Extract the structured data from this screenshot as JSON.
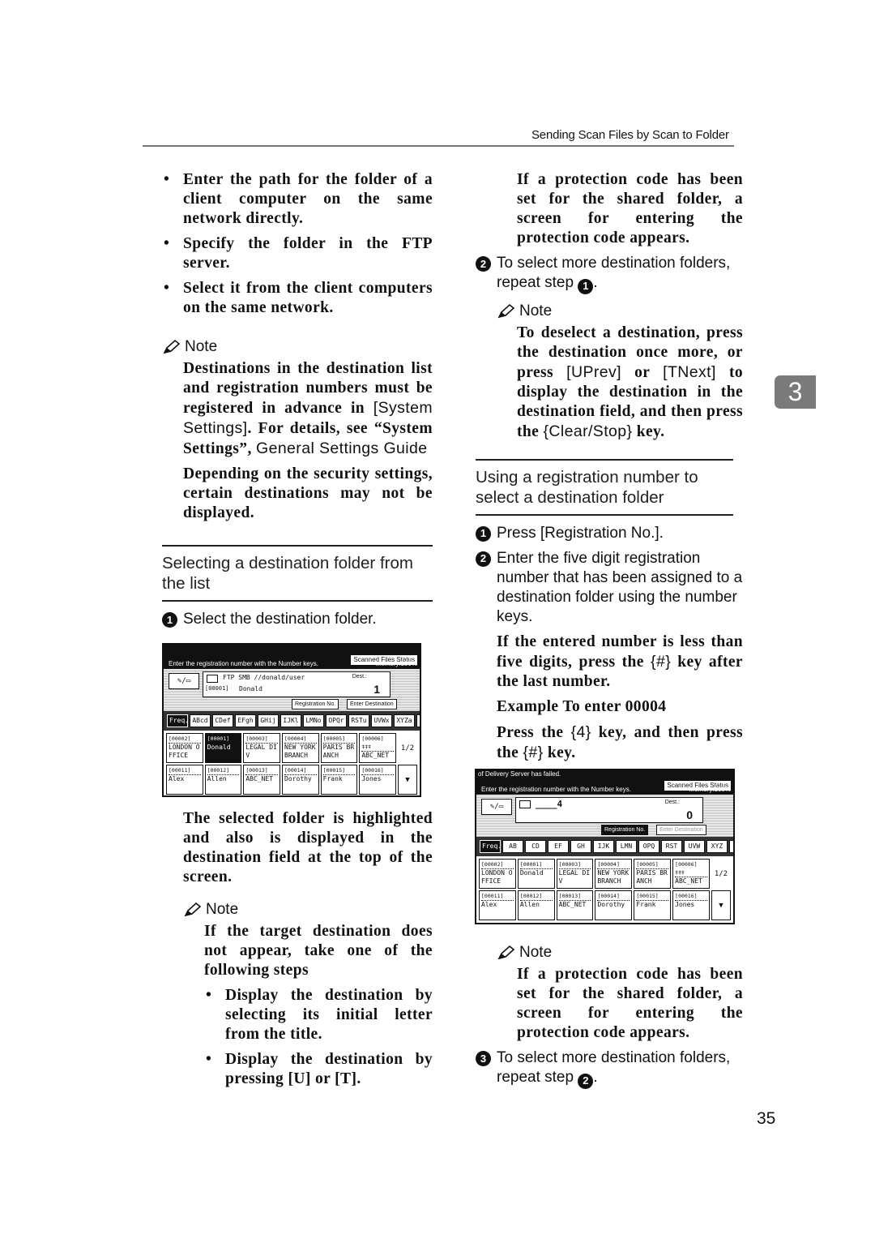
{
  "header": {
    "running_title": "Sending Scan Files by Scan to Folder"
  },
  "chapter_tab": "3",
  "page_number": "35",
  "left": {
    "bullets": [
      "Enter the path for the folder of a client computer on the same network directly.",
      "Specify the folder in the FTP server.",
      "Select it from the client computers on the same network."
    ],
    "note1": {
      "label": "Note",
      "p1_a": "Destinations in the destination list and registration numbers must be registered in advance in ",
      "p1_key": "[System Settings]",
      "p1_b": ". For details, see “System Settings”, ",
      "p1_ref": "General Settings Guide",
      "p2": "Depending on the security settings, certain destinations may not be displayed."
    },
    "section_title": "Selecting a destination folder from the list",
    "step1": {
      "num": "1",
      "text": "Select the destination folder."
    },
    "after_screen": "The selected folder is highlighted and also is displayed in the destination field at the top of the screen.",
    "note2": {
      "label": "Note",
      "intro": "If the target destination does not appear, take one of the following steps",
      "bullets": [
        "Display the destination by selecting its initial letter from the title.",
        "Display the destination by pressing [U] or [T]."
      ]
    }
  },
  "right": {
    "top_note": "If a protection code has been set for the shared folder, a screen for entering the protection code appears.",
    "step2": {
      "num": "2",
      "text": "To select more destination folders, repeat step ",
      "ref": "1"
    },
    "note3": {
      "label": "Note",
      "text_a": "To deselect a destination, press the destination once more, or press ",
      "key_prev": "[UPrev]",
      "text_b": " or ",
      "key_next": "[TNext]",
      "text_c": " to display the destination in the destination field, and then press the ",
      "key_clear": "{Clear/Stop}",
      "text_d": " key."
    },
    "section_title": "Using a registration number to select a destination folder",
    "steps": [
      {
        "num": "1",
        "text_a": "Press ",
        "key": "[Registration No.]",
        "text_b": "."
      },
      {
        "num": "2",
        "text": "Enter the five digit registration number that has been assigned to a destination folder using the number keys."
      }
    ],
    "hint_a": "If the entered number is less than five digits, press the ",
    "hint_key": "{#}",
    "hint_b": " key after the last number.",
    "example_title": "Example To enter 00004",
    "example_a": "Press the ",
    "example_key1": "{4}",
    "example_b": " key, and then press the ",
    "example_key2": "{#}",
    "example_c": " key.",
    "note4": {
      "label": "Note",
      "text": "If a protection code has been set for the shared folder, a screen for entering the protection code appears."
    },
    "step3": {
      "num": "3",
      "text": "To select more destination folders, repeat step ",
      "ref": "2"
    }
  },
  "screen1": {
    "status_line": "",
    "scanned_files_status": "Scanned Files Status",
    "message": "Enter the registration number with the Number keys.",
    "memory": "Memory:100%",
    "dest_protocol": "FTP  SMB //donald/user",
    "dest_regno": "[00001]",
    "dest_name": "Donald",
    "dest_label": "Dest.:",
    "dest_count": "1",
    "btn_regno": "Registration No.",
    "btn_enter_dest": "Enter Destination",
    "tabs": [
      "Freq.",
      "ABcd",
      "CDef",
      "EFgh",
      "GHij",
      "IJKl",
      "LMNo",
      "OPQr",
      "RSTu",
      "UVWx",
      "XYZa"
    ],
    "selected_tab": 0,
    "page_indicator": "1/2",
    "rows": [
      [
        {
          "rn": "[00002]",
          "name": "LONDON O FFICE"
        },
        {
          "rn": "[00001]",
          "name": "Donald",
          "selected": true
        },
        {
          "rn": "[00003]",
          "name": "LEGAL DI V"
        },
        {
          "rn": "[00004]",
          "name": "NEW YORK BRANCH"
        },
        {
          "rn": "[00005]",
          "name": "PARIS BR ANCH"
        },
        {
          "rn": "[00006] ‡‡‡",
          "name": "ABC_NET"
        }
      ],
      [
        {
          "rn": "[00011]",
          "name": "Alex"
        },
        {
          "rn": "[00012]",
          "name": "Allen"
        },
        {
          "rn": "[00013]",
          "name": "ABC_NET"
        },
        {
          "rn": "[00014]",
          "name": "Dorothy"
        },
        {
          "rn": "[00015]",
          "name": "Frank"
        },
        {
          "rn": "[00016]",
          "name": "Jones"
        }
      ]
    ]
  },
  "screen2": {
    "status_line": "of Delivery Server has failed.",
    "scanned_files_status": "Scanned Files Status",
    "message": "Enter the registration number with the Number keys.",
    "memory": "Memory:100%",
    "dest_entry": "____4",
    "dest_label": "Dest.:",
    "dest_count": "0",
    "btn_regno": "Registration No.",
    "btn_enter_dest": "Enter Destination",
    "tabs": [
      "Freq.",
      "AB",
      "CD",
      "EF",
      "GH",
      "IJK",
      "LMN",
      "OPQ",
      "RST",
      "UVW",
      "XYZ"
    ],
    "selected_tab": 0,
    "page_indicator": "1/2",
    "rows": [
      [
        {
          "rn": "[00002]",
          "name": "LONDON O FFICE"
        },
        {
          "rn": "[00001]",
          "name": "Donald"
        },
        {
          "rn": "[00003]",
          "name": "LEGAL DI V"
        },
        {
          "rn": "[00004]",
          "name": "NEW YORK BRANCH"
        },
        {
          "rn": "[00005]",
          "name": "PARIS BR ANCH"
        },
        {
          "rn": "[00006] ‡‡‡",
          "name": "ABC_NET"
        }
      ],
      [
        {
          "rn": "[00011]",
          "name": "Alex"
        },
        {
          "rn": "[00012]",
          "name": "Allen"
        },
        {
          "rn": "[00013]",
          "name": "ABC_NET"
        },
        {
          "rn": "[00014]",
          "name": "Dorothy"
        },
        {
          "rn": "[00015]",
          "name": "Frank"
        },
        {
          "rn": "[00016]",
          "name": "Jones"
        }
      ]
    ]
  }
}
